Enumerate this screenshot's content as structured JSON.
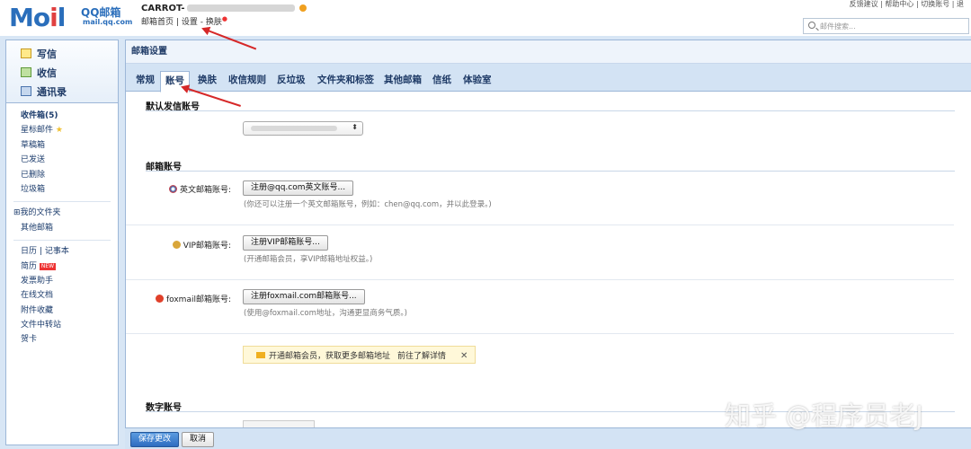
{
  "header": {
    "logo_main": "M",
    "logo_i": "i",
    "logo_rest": "l",
    "logo_qq": "QQ邮箱",
    "logo_url": "mail.qq.com",
    "account_name": "CARROT-",
    "nav_home": "邮箱首页",
    "nav_sep": "|",
    "nav_settings": "设置",
    "nav_dash": "-",
    "nav_skin": "换肤",
    "top_links": "反馈建议 | 帮助中心 | 切换账号 | 退",
    "search_placeholder": "邮件搜索..."
  },
  "sidebar": {
    "quick": [
      "写信",
      "收信",
      "通讯录"
    ],
    "inbox": "收件箱(5)",
    "starred": "星标邮件",
    "drafts": "草稿箱",
    "sent": "已发送",
    "deleted": "已删除",
    "spam": "垃圾箱",
    "my_folders": "⊞我的文件夹",
    "other_mail": "其他邮箱",
    "calendar": "日历",
    "bar": "|",
    "notes": "记事本",
    "resume": "简历",
    "new_badge": "NEW",
    "invoice": "发票助手",
    "docs": "在线文档",
    "attachments": "附件收藏",
    "transfer": "文件中转站",
    "cards": "贺卡"
  },
  "main": {
    "title": "邮箱设置",
    "tabs": [
      "常规",
      "账号",
      "换肤",
      "收信规则",
      "反垃圾",
      "文件夹和标签",
      "其他邮箱",
      "信纸",
      "体验室"
    ],
    "active_tab": "账号",
    "section_default": "默认发信账号",
    "section_mailbox": "邮箱账号",
    "section_digital": "数字账号",
    "english_label": "英文邮箱账号:",
    "english_button": "注册@qq.com英文账号...",
    "english_hint": "(你还可以注册一个英文邮箱账号，例如：chen@qq.com，并以此登录。)",
    "vip_label": "VIP邮箱账号:",
    "vip_button": "注册VIP邮箱账号...",
    "vip_hint": "(开通邮箱会员，享VIP邮箱地址权益。)",
    "foxmail_label": "foxmail邮箱账号:",
    "foxmail_button": "注册foxmail.com邮箱账号...",
    "foxmail_hint": "(使用@foxmail.com地址，沟通更显商务气质。)",
    "promo_text": "开通邮箱会员，获取更多邮箱地址",
    "promo_link": "前往了解详情",
    "promo_close": "✕"
  },
  "footer": {
    "save": "保存更改",
    "cancel": "取消"
  },
  "watermark": "知乎 @程序员老J",
  "colors": {
    "accent": "#2a6ebb",
    "annotation": "#d62828",
    "panel_band": "#d8e6f5"
  }
}
